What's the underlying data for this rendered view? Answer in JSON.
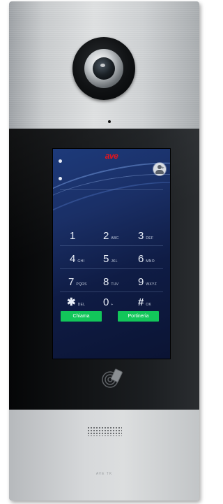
{
  "screen": {
    "brand_logo": "ave",
    "keypad": [
      {
        "digit": "1",
        "sub": ""
      },
      {
        "digit": "2",
        "sub": "ABC"
      },
      {
        "digit": "3",
        "sub": "DEF"
      },
      {
        "digit": "4",
        "sub": "GHI"
      },
      {
        "digit": "5",
        "sub": "JKL"
      },
      {
        "digit": "6",
        "sub": "MNO"
      },
      {
        "digit": "7",
        "sub": "PQRS"
      },
      {
        "digit": "8",
        "sub": "TUV"
      },
      {
        "digit": "9",
        "sub": "WXYZ"
      },
      {
        "digit": "✱",
        "sub": "DEL"
      },
      {
        "digit": "0",
        "sub": "+"
      },
      {
        "digit": "#",
        "sub": "OK"
      }
    ],
    "call_button_label": "Chiama",
    "concierge_button_label": "Portineria"
  },
  "panel": {
    "imprint": "AVE TK"
  },
  "icons": {
    "camera": "camera-icon",
    "avatar": "user-add-icon",
    "rfid": "rfid-icon",
    "speaker": "speaker-grille-icon"
  },
  "colors": {
    "logo": "#e8141b",
    "button": "#12c65a",
    "screen": "#1a2f66"
  }
}
